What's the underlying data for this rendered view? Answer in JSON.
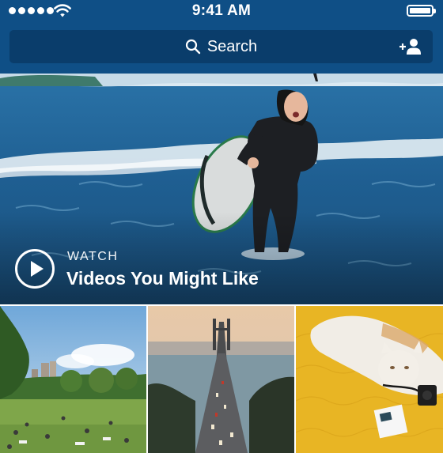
{
  "status_bar": {
    "time": "9:41 AM",
    "signal_icon": "signal-dots-icon",
    "wifi_icon": "wifi-icon",
    "battery_icon": "battery-icon",
    "battery_level": 1.0
  },
  "search": {
    "label": "Search",
    "search_icon": "search-icon",
    "add_user_icon": "add-person-icon"
  },
  "hero": {
    "kicker": "WATCH",
    "title": "Videos You Might Like",
    "play_icon": "play-icon"
  },
  "thumbnails": [
    {
      "subject": "park"
    },
    {
      "subject": "bridge"
    },
    {
      "subject": "cat"
    }
  ],
  "colors": {
    "header_bg": "#0f4f86",
    "search_bg": "#0a3d6b",
    "text_on_dark": "#ffffff"
  }
}
